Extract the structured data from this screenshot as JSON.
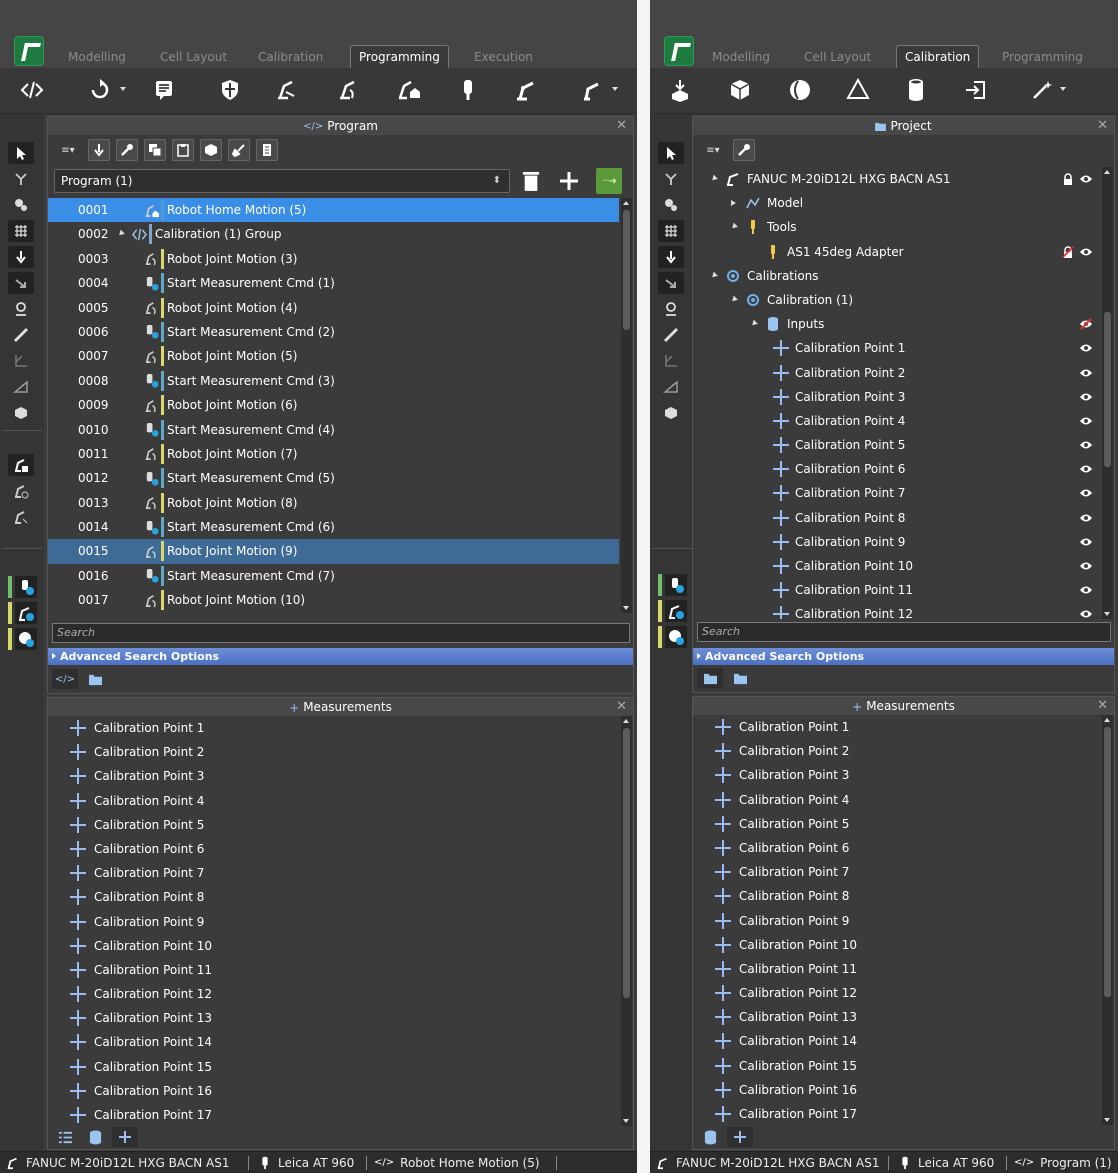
{
  "left": {
    "tabs": [
      "Modelling",
      "Cell Layout",
      "Calibration",
      "Programming",
      "Execution"
    ],
    "active_tab": "Programming",
    "program_panel": {
      "title": "Program",
      "dropdown_value": "Program (1)",
      "rows": [
        {
          "num": "0001",
          "label": "Robot Home Motion (5)",
          "kind": "home",
          "bar": "#4f9ad8"
        },
        {
          "num": "0002",
          "label": "Calibration (1) Group",
          "kind": "group",
          "bar": "#7ea7c9"
        },
        {
          "num": "0003",
          "label": "Robot Joint Motion (3)",
          "kind": "joint",
          "bar": "#d9d96b"
        },
        {
          "num": "0004",
          "label": "Start Measurement Cmd (1)",
          "kind": "meas",
          "bar": "#5fa9c8"
        },
        {
          "num": "0005",
          "label": "Robot Joint Motion (4)",
          "kind": "joint",
          "bar": "#d9d96b"
        },
        {
          "num": "0006",
          "label": "Start Measurement Cmd (2)",
          "kind": "meas",
          "bar": "#5fa9c8"
        },
        {
          "num": "0007",
          "label": "Robot Joint Motion (5)",
          "kind": "joint",
          "bar": "#d9d96b"
        },
        {
          "num": "0008",
          "label": "Start Measurement Cmd (3)",
          "kind": "meas",
          "bar": "#5fa9c8"
        },
        {
          "num": "0009",
          "label": "Robot Joint Motion (6)",
          "kind": "joint",
          "bar": "#d9d96b"
        },
        {
          "num": "0010",
          "label": "Start Measurement Cmd (4)",
          "kind": "meas",
          "bar": "#5fa9c8"
        },
        {
          "num": "0011",
          "label": "Robot Joint Motion (7)",
          "kind": "joint",
          "bar": "#d9d96b"
        },
        {
          "num": "0012",
          "label": "Start Measurement Cmd (5)",
          "kind": "meas",
          "bar": "#5fa9c8"
        },
        {
          "num": "0013",
          "label": "Robot Joint Motion (8)",
          "kind": "joint",
          "bar": "#d9d96b"
        },
        {
          "num": "0014",
          "label": "Start Measurement Cmd (6)",
          "kind": "meas",
          "bar": "#5fa9c8"
        },
        {
          "num": "0015",
          "label": "Robot Joint Motion (9)",
          "kind": "joint",
          "bar": "#d9d96b"
        },
        {
          "num": "0016",
          "label": "Start Measurement Cmd (7)",
          "kind": "meas",
          "bar": "#5fa9c8"
        },
        {
          "num": "0017",
          "label": "Robot Joint Motion (10)",
          "kind": "joint",
          "bar": "#d9d96b"
        }
      ],
      "selected_primary": "0001",
      "selected_secondary": "0015",
      "search_placeholder": "Search",
      "advanced_label": "Advanced Search Options"
    },
    "measurements_panel": {
      "title": "Measurements",
      "items": [
        "Calibration Point 1",
        "Calibration Point 2",
        "Calibration Point 3",
        "Calibration Point 4",
        "Calibration Point 5",
        "Calibration Point 6",
        "Calibration Point 7",
        "Calibration Point 8",
        "Calibration Point 9",
        "Calibration Point 10",
        "Calibration Point 11",
        "Calibration Point 12",
        "Calibration Point 13",
        "Calibration Point 14",
        "Calibration Point 15",
        "Calibration Point 16",
        "Calibration Point 17"
      ]
    },
    "status": {
      "robot": "FANUC M-20iD12L HXG BACN AS1",
      "tracker": "Leica AT 960",
      "item": "Robot Home Motion (5)"
    }
  },
  "right": {
    "tabs": [
      "Modelling",
      "Cell Layout",
      "Calibration",
      "Programming"
    ],
    "active_tab": "Calibration",
    "project_panel": {
      "title": "Project",
      "tree": [
        {
          "label": "FANUC M-20iD12L HXG BACN AS1",
          "depth": 0,
          "exp": "open",
          "icon": "robot",
          "eye": "eye",
          "lock": true
        },
        {
          "label": "Model",
          "depth": 1,
          "exp": "closed",
          "icon": "model",
          "eye": ""
        },
        {
          "label": "Tools",
          "depth": 1,
          "exp": "open",
          "icon": "tool",
          "eye": ""
        },
        {
          "label": "AS1 45deg Adapter",
          "depth": 2,
          "exp": "",
          "icon": "tool",
          "eye": "eye",
          "lock_red": true
        },
        {
          "label": "Calibrations",
          "depth": 0,
          "exp": "open",
          "icon": "calib",
          "eye": ""
        },
        {
          "label": "Calibration (1)",
          "depth": 1,
          "exp": "open",
          "icon": "calib",
          "eye": ""
        },
        {
          "label": "Inputs",
          "depth": 2,
          "exp": "open",
          "icon": "cyl",
          "eye": "hidden"
        },
        {
          "label": "Calibration Point 1",
          "depth": 3,
          "exp": "",
          "icon": "cross",
          "eye": "eye"
        },
        {
          "label": "Calibration Point 2",
          "depth": 3,
          "exp": "",
          "icon": "cross",
          "eye": "eye"
        },
        {
          "label": "Calibration Point 3",
          "depth": 3,
          "exp": "",
          "icon": "cross",
          "eye": "eye"
        },
        {
          "label": "Calibration Point 4",
          "depth": 3,
          "exp": "",
          "icon": "cross",
          "eye": "eye"
        },
        {
          "label": "Calibration Point 5",
          "depth": 3,
          "exp": "",
          "icon": "cross",
          "eye": "eye"
        },
        {
          "label": "Calibration Point 6",
          "depth": 3,
          "exp": "",
          "icon": "cross",
          "eye": "eye"
        },
        {
          "label": "Calibration Point 7",
          "depth": 3,
          "exp": "",
          "icon": "cross",
          "eye": "eye"
        },
        {
          "label": "Calibration Point 8",
          "depth": 3,
          "exp": "",
          "icon": "cross",
          "eye": "eye"
        },
        {
          "label": "Calibration Point 9",
          "depth": 3,
          "exp": "",
          "icon": "cross",
          "eye": "eye"
        },
        {
          "label": "Calibration Point 10",
          "depth": 3,
          "exp": "",
          "icon": "cross",
          "eye": "eye"
        },
        {
          "label": "Calibration Point 11",
          "depth": 3,
          "exp": "",
          "icon": "cross",
          "eye": "eye"
        },
        {
          "label": "Calibration Point 12",
          "depth": 3,
          "exp": "",
          "icon": "cross",
          "eye": "eye"
        }
      ],
      "search_placeholder": "Search",
      "advanced_label": "Advanced Search Options"
    },
    "measurements_panel": {
      "title": "Measurements",
      "items": [
        "Calibration Point 1",
        "Calibration Point 2",
        "Calibration Point 3",
        "Calibration Point 4",
        "Calibration Point 5",
        "Calibration Point 6",
        "Calibration Point 7",
        "Calibration Point 8",
        "Calibration Point 9",
        "Calibration Point 10",
        "Calibration Point 11",
        "Calibration Point 12",
        "Calibration Point 13",
        "Calibration Point 14",
        "Calibration Point 15",
        "Calibration Point 16",
        "Calibration Point 17"
      ]
    },
    "status": {
      "robot": "FANUC M-20iD12L HXG BACN AS1",
      "tracker": "Leica AT 960",
      "item": "Program (1)"
    }
  },
  "colors": {
    "selection": "#3a8ee6",
    "selection_secondary": "#3e6a96",
    "advanced_bar": "#5a7fd0",
    "app_green": "#1f7a40"
  }
}
